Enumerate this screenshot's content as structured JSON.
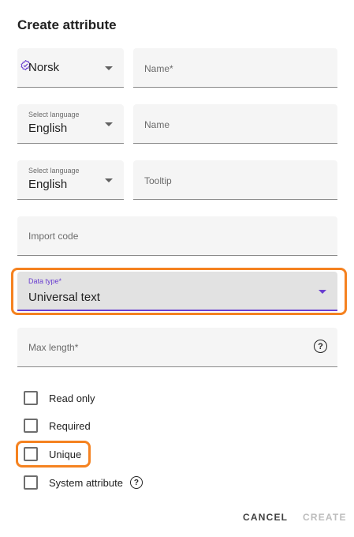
{
  "dialog": {
    "title": "Create attribute",
    "colors": {
      "accent": "#6a3fd0",
      "highlight": "#f58220",
      "field_bg": "#f5f5f5"
    }
  },
  "rows": [
    {
      "language": {
        "label": "",
        "value": "Norsk",
        "icon": "check-badge-icon"
      },
      "text": {
        "placeholder": "Name*"
      }
    },
    {
      "language": {
        "label": "Select language",
        "value": "English"
      },
      "text": {
        "placeholder": "Name"
      }
    },
    {
      "language": {
        "label": "Select language",
        "value": "English"
      },
      "text": {
        "placeholder": "Tooltip"
      }
    }
  ],
  "import_code": {
    "placeholder": "Import code"
  },
  "data_type": {
    "label": "Data type*",
    "value": "Universal text"
  },
  "max_length": {
    "placeholder": "Max length*",
    "icon": "help-icon"
  },
  "checkboxes": [
    {
      "label": "Read only",
      "checked": false
    },
    {
      "label": "Required",
      "checked": false
    },
    {
      "label": "Unique",
      "checked": false
    },
    {
      "label": "System attribute",
      "checked": false,
      "icon": "help-icon"
    }
  ],
  "actions": {
    "cancel": "CANCEL",
    "create": "CREATE"
  }
}
